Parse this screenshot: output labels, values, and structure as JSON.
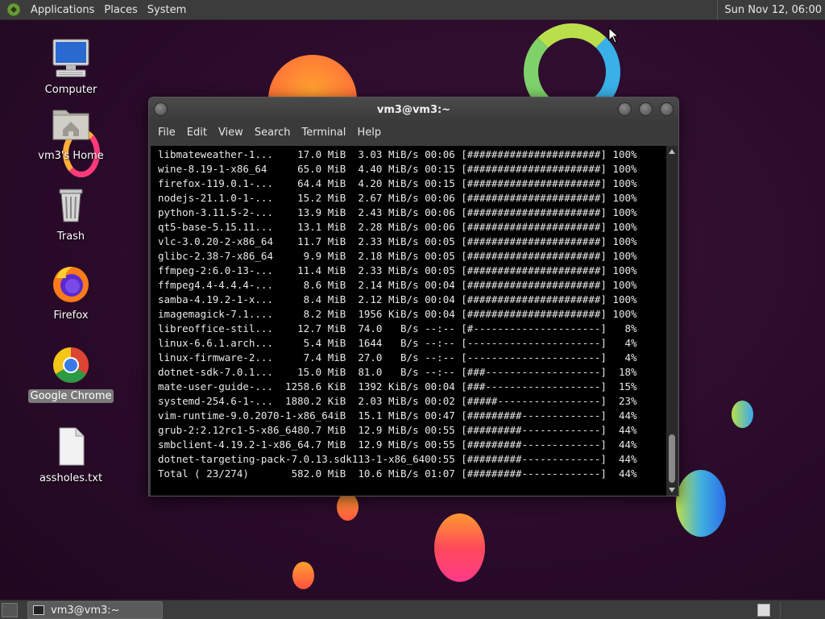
{
  "top_panel": {
    "menus": [
      "Applications",
      "Places",
      "System"
    ],
    "clock": "Sun Nov 12, 06:00"
  },
  "desktop": {
    "icons": [
      {
        "label": "Computer"
      },
      {
        "label": "vm3's Home"
      },
      {
        "label": "Trash"
      },
      {
        "label": "Firefox"
      },
      {
        "label": "Google Chrome"
      },
      {
        "label": "assholes.txt"
      }
    ]
  },
  "window": {
    "title": "vm3@vm3:~",
    "menus": [
      "File",
      "Edit",
      "View",
      "Search",
      "Terminal",
      "Help"
    ],
    "lines": [
      "libmateweather-1...    17.0 MiB  3.03 MiB/s 00:06 [######################] 100%",
      "wine-8.19-1-x86_64     65.0 MiB  4.40 MiB/s 00:15 [######################] 100%",
      "firefox-119.0.1-...    64.4 MiB  4.20 MiB/s 00:15 [######################] 100%",
      "nodejs-21.1.0-1-...    15.2 MiB  2.67 MiB/s 00:06 [######################] 100%",
      "python-3.11.5-2-...    13.9 MiB  2.43 MiB/s 00:06 [######################] 100%",
      "qt5-base-5.15.11...    13.1 MiB  2.28 MiB/s 00:06 [######################] 100%",
      "vlc-3.0.20-2-x86_64    11.7 MiB  2.33 MiB/s 00:05 [######################] 100%",
      "glibc-2.38-7-x86_64     9.9 MiB  2.18 MiB/s 00:05 [######################] 100%",
      "ffmpeg-2:6.0-13-...    11.4 MiB  2.33 MiB/s 00:05 [######################] 100%",
      "ffmpeg4.4-4.4.4-...     8.6 MiB  2.14 MiB/s 00:04 [######################] 100%",
      "samba-4.19.2-1-x...     8.4 MiB  2.12 MiB/s 00:04 [######################] 100%",
      "imagemagick-7.1....     8.2 MiB  1956 KiB/s 00:04 [######################] 100%",
      "libreoffice-stil...    12.7 MiB  74.0   B/s --:-- [#---------------------]   8%",
      "linux-6.6.1.arch...     5.4 MiB  1644   B/s --:-- [----------------------]   4%",
      "linux-firmware-2...     7.4 MiB  27.0   B/s --:-- [----------------------]   4%",
      "dotnet-sdk-7.0.1...    15.0 MiB  81.0   B/s --:-- [###-------------------]  18%",
      "mate-user-guide-...  1258.6 KiB  1392 KiB/s 00:04 [###-------------------]  15%",
      "systemd-254.6-1-...  1880.2 KiB  2.03 MiB/s 00:02 [#####-----------------]  23%",
      "vim-runtime-9.0.2070-1-x86_64iB  15.1 MiB/s 00:47 [#########-------------]  44%",
      "grub-2:2.12rc1-5-x86_6480.7 MiB  12.9 MiB/s 00:55 [#########-------------]  44%",
      "smbclient-4.19.2-1-x86_64.7 MiB  12.9 MiB/s 00:55 [#########-------------]  44%",
      "dotnet-targeting-pack-7.0.13.sdk113-1-x86_6400:55 [#########-------------]  44%",
      "Total ( 23/274)       582.0 MiB  10.6 MiB/s 01:07 [#########-------------]  44%"
    ]
  },
  "taskbar": {
    "task_label": "vm3@vm3:~"
  }
}
